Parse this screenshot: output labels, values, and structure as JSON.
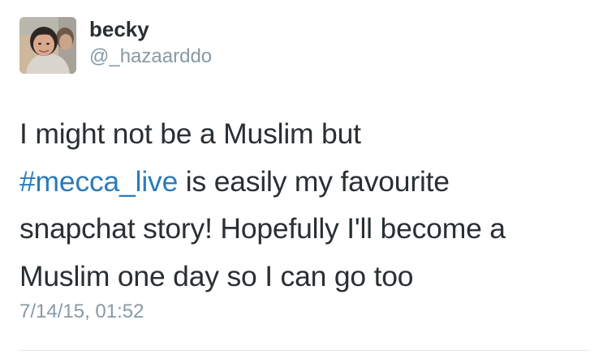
{
  "author": {
    "display_name": "becky",
    "handle": "@_hazaarddo",
    "avatar_icon": "profile-photo"
  },
  "tweet": {
    "line1": "I might not be a Muslim but",
    "hashtag": "#mecca_live",
    "line2_rest": " is easily my favourite",
    "line3": "snapchat story! Hopefully I'll become a",
    "line4": "Muslim one day so I can go too",
    "timestamp": "7/14/15, 01:52"
  },
  "colors": {
    "text": "#292f33",
    "secondary": "#8899a6",
    "link": "#2b7bb9",
    "divider": "#e1e8ed"
  }
}
